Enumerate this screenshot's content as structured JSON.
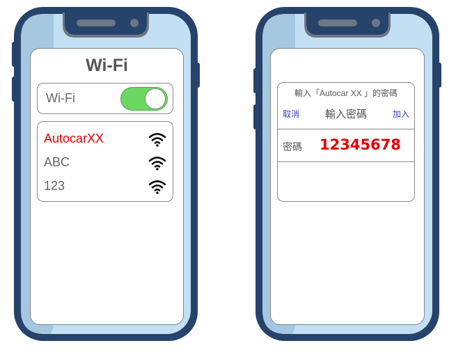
{
  "colors": {
    "phone_body": "#26436b",
    "phone_bezel": "#c3dff3",
    "phone_shade": "#a6c7e0",
    "toggle_on": "#6bd660",
    "highlight_red": "#e60000",
    "link_blue": "#3a3ad6",
    "text_gray": "#666666"
  },
  "left_phone": {
    "title": "Wi-Fi",
    "toggle": {
      "label": "Wi-Fi",
      "state": "on"
    },
    "networks": [
      {
        "name": "AutocarXX",
        "icon": "wifi-signal-icon",
        "selected": true
      },
      {
        "name": "ABC",
        "icon": "wifi-signal-icon",
        "selected": false
      },
      {
        "name": "123",
        "icon": "wifi-signal-icon",
        "selected": false
      }
    ]
  },
  "right_phone": {
    "dialog": {
      "prompt": "輸入「Autocar XX 」的密碼",
      "cancel_label": "取消",
      "title": "輸入密碼",
      "join_label": "加入",
      "password_label": "密碼",
      "password_value": "12345678"
    }
  }
}
